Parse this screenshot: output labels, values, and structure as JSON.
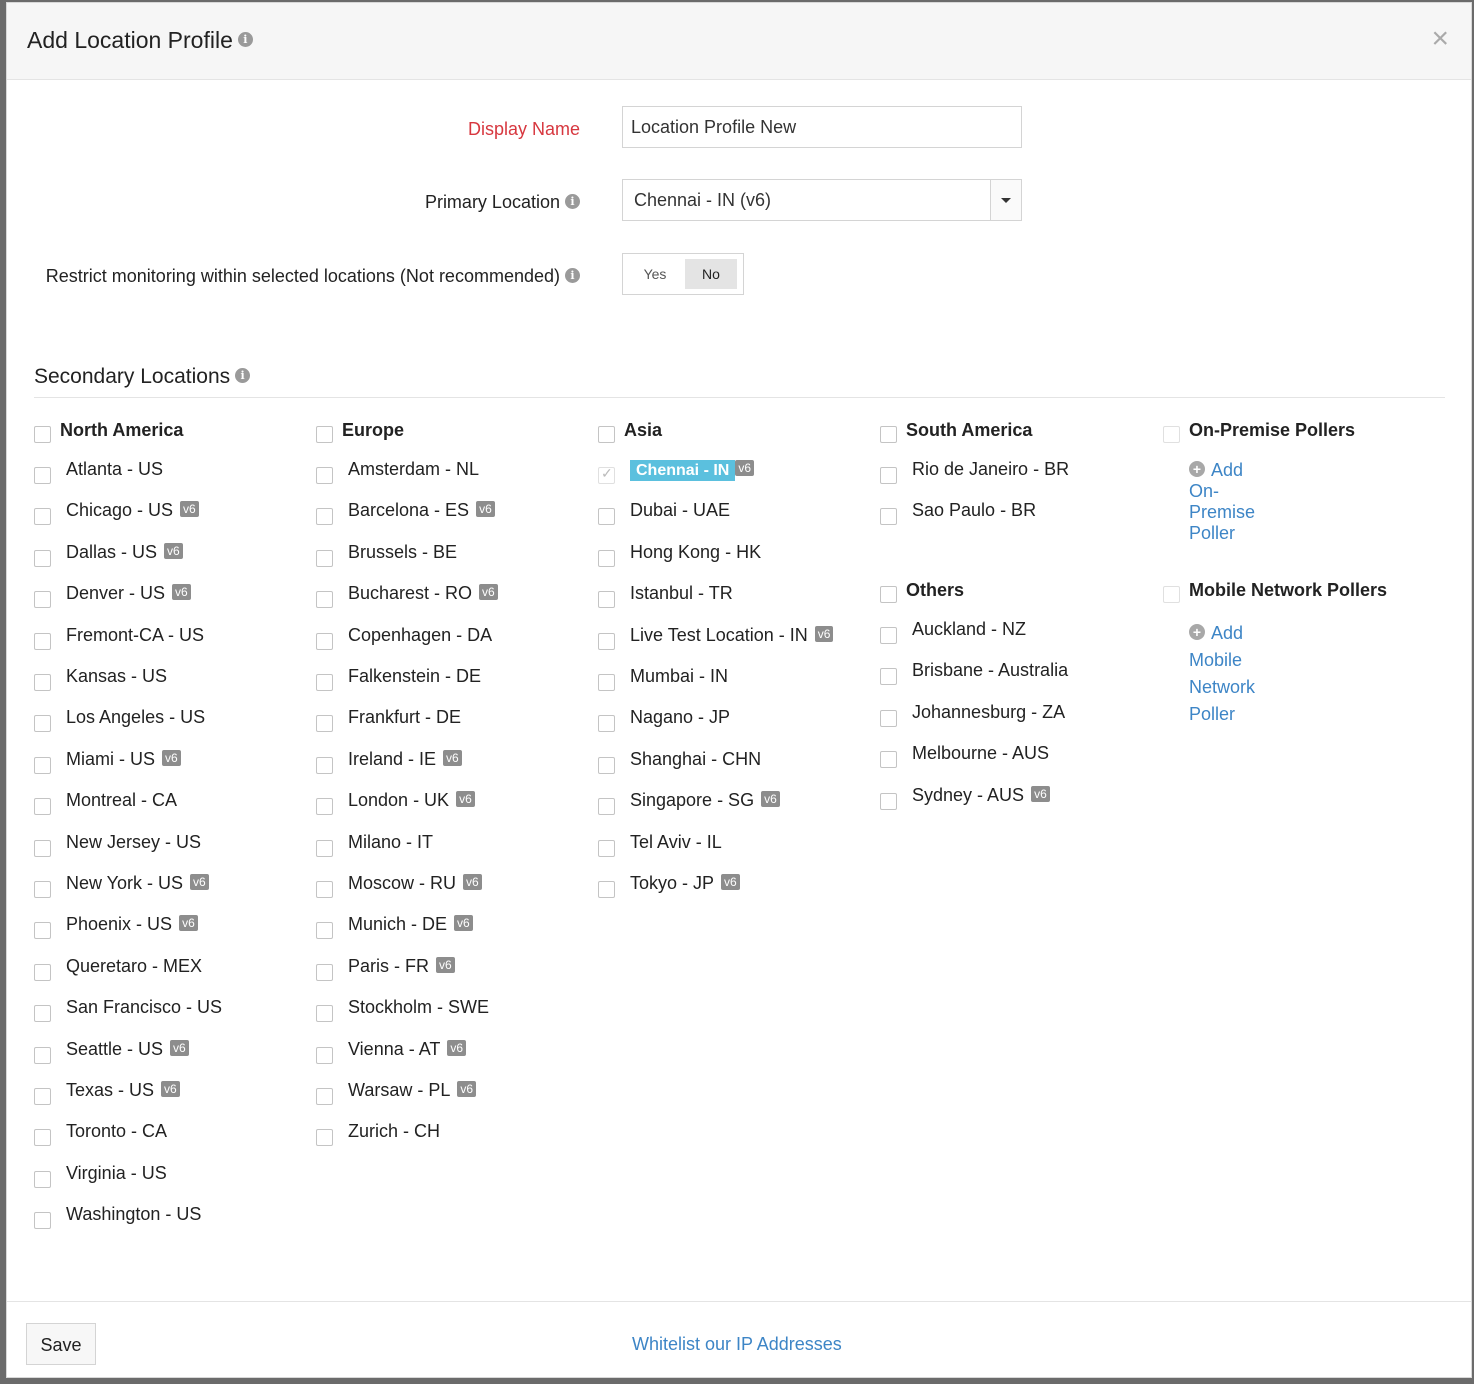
{
  "header": {
    "title": "Add Location Profile",
    "close": "×"
  },
  "form": {
    "display_name_label": "Display Name",
    "display_name_value": "Location Profile New",
    "primary_location_label": "Primary Location",
    "primary_location_value": "Chennai - IN (v6)",
    "restrict_label": "Restrict monitoring within selected locations (Not recommended)",
    "restrict_yes": "Yes",
    "restrict_no": "No",
    "restrict_selected": "No"
  },
  "secondary": {
    "title": "Secondary Locations",
    "badge_text": "v6",
    "groups": {
      "north_america": {
        "title": "North America",
        "items": [
          {
            "label": "Atlanta - US",
            "v6": false
          },
          {
            "label": "Chicago - US",
            "v6": true
          },
          {
            "label": "Dallas - US",
            "v6": true
          },
          {
            "label": "Denver - US",
            "v6": true
          },
          {
            "label": "Fremont-CA - US",
            "v6": false
          },
          {
            "label": "Kansas - US",
            "v6": false
          },
          {
            "label": "Los Angeles - US",
            "v6": false
          },
          {
            "label": "Miami - US",
            "v6": true
          },
          {
            "label": "Montreal - CA",
            "v6": false
          },
          {
            "label": "New Jersey - US",
            "v6": false
          },
          {
            "label": "New York - US",
            "v6": true
          },
          {
            "label": "Phoenix - US",
            "v6": true
          },
          {
            "label": "Queretaro - MEX",
            "v6": false
          },
          {
            "label": "San Francisco - US",
            "v6": false
          },
          {
            "label": "Seattle - US",
            "v6": true
          },
          {
            "label": "Texas - US",
            "v6": true
          },
          {
            "label": "Toronto - CA",
            "v6": false
          },
          {
            "label": "Virginia - US",
            "v6": false
          },
          {
            "label": "Washington - US",
            "v6": false
          }
        ]
      },
      "europe": {
        "title": "Europe",
        "items": [
          {
            "label": "Amsterdam - NL",
            "v6": false
          },
          {
            "label": "Barcelona - ES",
            "v6": true
          },
          {
            "label": "Brussels - BE",
            "v6": false
          },
          {
            "label": "Bucharest - RO",
            "v6": true
          },
          {
            "label": "Copenhagen - DA",
            "v6": false
          },
          {
            "label": "Falkenstein - DE",
            "v6": false
          },
          {
            "label": "Frankfurt - DE",
            "v6": false
          },
          {
            "label": "Ireland - IE",
            "v6": true
          },
          {
            "label": "London - UK",
            "v6": true
          },
          {
            "label": "Milano - IT",
            "v6": false
          },
          {
            "label": "Moscow - RU",
            "v6": true
          },
          {
            "label": "Munich - DE",
            "v6": true
          },
          {
            "label": "Paris - FR",
            "v6": true
          },
          {
            "label": "Stockholm - SWE",
            "v6": false
          },
          {
            "label": "Vienna - AT",
            "v6": true
          },
          {
            "label": "Warsaw - PL",
            "v6": true
          },
          {
            "label": "Zurich - CH",
            "v6": false
          }
        ]
      },
      "asia": {
        "title": "Asia",
        "items": [
          {
            "label": "Chennai - IN",
            "v6": true,
            "primary": true
          },
          {
            "label": "Dubai - UAE",
            "v6": false
          },
          {
            "label": "Hong Kong - HK",
            "v6": false
          },
          {
            "label": "Istanbul - TR",
            "v6": false
          },
          {
            "label": "Live Test Location - IN",
            "v6": true
          },
          {
            "label": "Mumbai - IN",
            "v6": false
          },
          {
            "label": "Nagano - JP",
            "v6": false
          },
          {
            "label": "Shanghai - CHN",
            "v6": false
          },
          {
            "label": "Singapore - SG",
            "v6": true
          },
          {
            "label": "Tel Aviv - IL",
            "v6": false
          },
          {
            "label": "Tokyo - JP",
            "v6": true
          }
        ]
      },
      "south_america": {
        "title": "South America",
        "items": [
          {
            "label": "Rio de Janeiro - BR",
            "v6": false
          },
          {
            "label": "Sao Paulo - BR",
            "v6": false
          }
        ]
      },
      "others": {
        "title": "Others",
        "items": [
          {
            "label": "Auckland - NZ",
            "v6": false
          },
          {
            "label": "Brisbane - Australia",
            "v6": false
          },
          {
            "label": "Johannesburg - ZA",
            "v6": false
          },
          {
            "label": "Melbourne - AUS",
            "v6": false
          },
          {
            "label": "Sydney - AUS",
            "v6": true
          }
        ]
      },
      "on_premise": {
        "title": "On-Premise Pollers",
        "add_link": "Add On-Premise Poller"
      },
      "mobile": {
        "title": "Mobile Network Pollers",
        "add_link_line1": "Add Mobile Network",
        "add_link_line2": "Poller"
      }
    }
  },
  "footer": {
    "save_label": "Save",
    "whitelist_link": "Whitelist our IP Addresses"
  },
  "colors": {
    "required_label": "#d7373f",
    "link": "#3d85c6",
    "highlight": "#5bc0de",
    "badge": "#8d8d8d"
  }
}
